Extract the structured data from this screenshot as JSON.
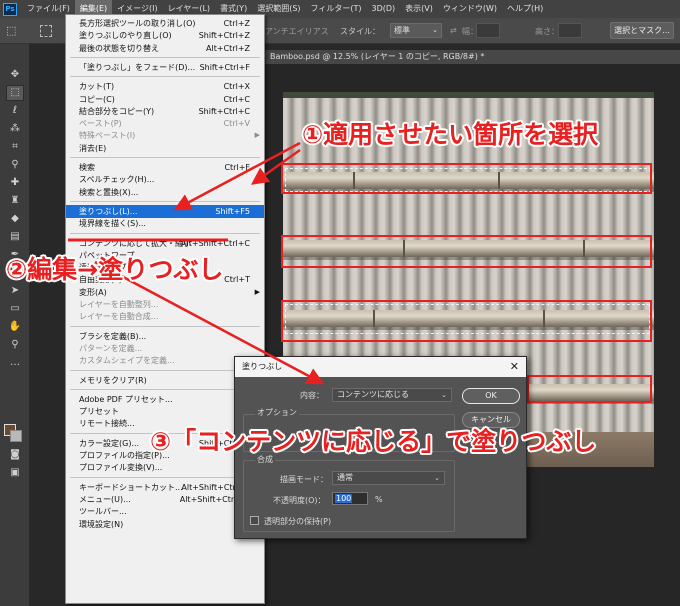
{
  "app": {
    "logo_text": "Ps",
    "menubar": [
      {
        "label": "ファイル(F)",
        "active": false
      },
      {
        "label": "編集(E)",
        "active": true
      },
      {
        "label": "イメージ(I)",
        "active": false
      },
      {
        "label": "レイヤー(L)",
        "active": false
      },
      {
        "label": "書式(Y)",
        "active": false
      },
      {
        "label": "選択範囲(S)",
        "active": false
      },
      {
        "label": "フィルター(T)",
        "active": false
      },
      {
        "label": "3D(D)",
        "active": false
      },
      {
        "label": "表示(V)",
        "active": false
      },
      {
        "label": "ウィンドウ(W)",
        "active": false
      },
      {
        "label": "ヘルプ(H)",
        "active": false
      }
    ]
  },
  "options_bar": {
    "antialias_label": "アンチエイリアス",
    "style_label": "スタイル：",
    "style_value": "標準",
    "width_label": "幅：",
    "height_label": "高さ：",
    "select_mask_button": "選択とマスク..."
  },
  "document": {
    "tab_title": "Bamboo.psd @ 12.5% (レイヤー 1 のコピー, RGB/8#) *"
  },
  "edit_menu": {
    "items": [
      {
        "label": "長方形選択ツールの取り消し(O)",
        "shortcut": "Ctrl+Z",
        "state": "normal"
      },
      {
        "label": "塗りつぶしのやり直し(O)",
        "shortcut": "Shift+Ctrl+Z",
        "state": "normal"
      },
      {
        "label": "最後の状態を切り替え",
        "shortcut": "Alt+Ctrl+Z",
        "state": "normal"
      },
      {
        "sep": true
      },
      {
        "label": "「塗りつぶし」をフェード(D)...",
        "shortcut": "Shift+Ctrl+F",
        "state": "normal"
      },
      {
        "sep": true
      },
      {
        "label": "カット(T)",
        "shortcut": "Ctrl+X",
        "state": "normal"
      },
      {
        "label": "コピー(C)",
        "shortcut": "Ctrl+C",
        "state": "normal"
      },
      {
        "label": "結合部分をコピー(Y)",
        "shortcut": "Shift+Ctrl+C",
        "state": "normal"
      },
      {
        "label": "ペースト(P)",
        "shortcut": "Ctrl+V",
        "state": "disabled"
      },
      {
        "label": "特殊ペースト(I)",
        "shortcut": "",
        "state": "disabled",
        "submenu": true
      },
      {
        "label": "消去(E)",
        "shortcut": "",
        "state": "normal"
      },
      {
        "sep": true
      },
      {
        "label": "検索",
        "shortcut": "Ctrl+F",
        "state": "normal"
      },
      {
        "label": "スペルチェック(H)...",
        "shortcut": "",
        "state": "normal"
      },
      {
        "label": "検索と置換(X)...",
        "shortcut": "",
        "state": "normal"
      },
      {
        "sep": true
      },
      {
        "label": "塗りつぶし(L)...",
        "shortcut": "Shift+F5",
        "state": "highlighted"
      },
      {
        "label": "境界線を描く(S)...",
        "shortcut": "",
        "state": "normal"
      },
      {
        "sep": true
      },
      {
        "label": "コンテンツに応じて拡大・縮小",
        "shortcut": "Alt+Shift+Ctrl+C",
        "state": "normal"
      },
      {
        "label": "パペットワープ",
        "shortcut": "",
        "state": "normal"
      },
      {
        "label": "遠近法ワープ",
        "shortcut": "",
        "state": "normal"
      },
      {
        "label": "自由変形(F)",
        "shortcut": "Ctrl+T",
        "state": "normal"
      },
      {
        "label": "変形(A)",
        "shortcut": "",
        "state": "normal",
        "submenu": true
      },
      {
        "label": "レイヤーを自動整列...",
        "shortcut": "",
        "state": "disabled"
      },
      {
        "label": "レイヤーを自動合成...",
        "shortcut": "",
        "state": "disabled"
      },
      {
        "sep": true
      },
      {
        "label": "ブラシを定義(B)...",
        "shortcut": "",
        "state": "normal"
      },
      {
        "label": "パターンを定義...",
        "shortcut": "",
        "state": "disabled"
      },
      {
        "label": "カスタムシェイプを定義...",
        "shortcut": "",
        "state": "disabled"
      },
      {
        "sep": true
      },
      {
        "label": "メモリをクリア(R)",
        "shortcut": "",
        "state": "normal",
        "submenu": true
      },
      {
        "sep": true
      },
      {
        "label": "Adobe PDF プリセット...",
        "shortcut": "",
        "state": "normal"
      },
      {
        "label": "プリセット",
        "shortcut": "",
        "state": "normal",
        "submenu": true
      },
      {
        "label": "リモート接続...",
        "shortcut": "",
        "state": "normal"
      },
      {
        "sep": true
      },
      {
        "label": "カラー設定(G)...",
        "shortcut": "Shift+Ctrl+K",
        "state": "normal"
      },
      {
        "label": "プロファイルの指定(P)...",
        "shortcut": "",
        "state": "normal"
      },
      {
        "label": "プロファイル変換(V)...",
        "shortcut": "",
        "state": "normal"
      },
      {
        "sep": true
      },
      {
        "label": "キーボードショートカット...",
        "shortcut": "Alt+Shift+Ctrl+K",
        "state": "normal"
      },
      {
        "label": "メニュー(U)...",
        "shortcut": "Alt+Shift+Ctrl+M",
        "state": "normal"
      },
      {
        "label": "ツールバー...",
        "shortcut": "",
        "state": "normal"
      },
      {
        "label": "環境設定(N)",
        "shortcut": "",
        "state": "normal",
        "submenu": true
      }
    ]
  },
  "fill_dialog": {
    "title": "塗りつぶし",
    "content_label": "内容：",
    "content_value": "コンテンツに応じる",
    "ok_button": "OK",
    "cancel_button": "キャンセル",
    "options_group_title": "オプション",
    "color_adapt_fragment": "カ",
    "blend_group_title": "合成",
    "mode_label": "描画モード：",
    "mode_value": "通常",
    "opacity_label": "不透明度(O)：",
    "opacity_value": "100",
    "opacity_unit": "%",
    "preserve_transparency_label": "透明部分の保持(P)",
    "preserve_transparency_checked": false
  },
  "annotations": {
    "step1": "①適用させたい箇所を選択",
    "step2": "②編集→塗りつぶし",
    "step3": "③「コンテンツに応じる」で塗りつぶし",
    "color": "#e82020"
  },
  "tools": [
    "move-icon",
    "marquee-icon",
    "lasso-icon",
    "magic-wand-icon",
    "crop-icon",
    "eyedropper-icon",
    "healing-brush-icon",
    "brush-icon",
    "clone-stamp-icon",
    "history-brush-icon",
    "eraser-icon",
    "gradient-icon",
    "blur-icon",
    "dodge-icon",
    "pen-icon",
    "type-icon",
    "path-select-icon",
    "rectangle-icon",
    "hand-icon",
    "zoom-icon",
    "more-tools-icon"
  ]
}
